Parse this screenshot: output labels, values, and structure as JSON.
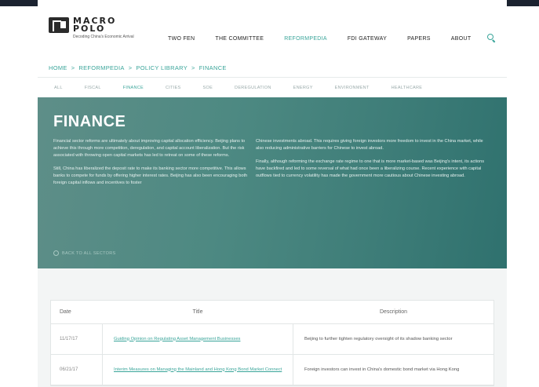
{
  "logo": {
    "line1": "MACRO",
    "line2": "POLO",
    "tagline": "Decoding China's Economic Arrival"
  },
  "nav": {
    "items": [
      {
        "label": "TWO FEN",
        "active": false
      },
      {
        "label": "THE COMMITTEE",
        "active": false
      },
      {
        "label": "REFORMPEDIA",
        "active": true
      },
      {
        "label": "FDI GATEWAY",
        "active": false
      },
      {
        "label": "PAPERS",
        "active": false
      },
      {
        "label": "ABOUT",
        "active": false
      }
    ],
    "search_icon": "search-icon"
  },
  "breadcrumb": {
    "items": [
      "HOME",
      "REFORMPEDIA",
      "POLICY LIBRARY",
      "FINANCE"
    ],
    "separator": ">"
  },
  "tabs": [
    {
      "label": "ALL",
      "active": false
    },
    {
      "label": "FISCAL",
      "active": false
    },
    {
      "label": "FINANCE",
      "active": true
    },
    {
      "label": "CITIES",
      "active": false
    },
    {
      "label": "SOE",
      "active": false
    },
    {
      "label": "DEREGULATION",
      "active": false
    },
    {
      "label": "ENERGY",
      "active": false
    },
    {
      "label": "ENVIRONMENT",
      "active": false
    },
    {
      "label": "HEALTHCARE",
      "active": false
    }
  ],
  "hero": {
    "title": "FINANCE",
    "left_paragraphs": [
      "Financial sector reforms are ultimately about improving capital allocation efficiency. Beijing plans to achieve this through more competition, deregulation, and capital account liberalization. But the risk associated with throwing open capital markets has led to retreat on some of these reforms.",
      "Still, China has liberalized the deposit rate to make its banking sector more competitive. This allows banks to compete for funds by offering higher interest rates. Beijing has also been encouraging both foreign capital inflows and incentives to foster"
    ],
    "right_paragraphs": [
      "Chinese investments abroad. This requires giving foreign investors more freedom to invest in the China market, while also reducing administrative barriers for Chinese to invest abroad.",
      "Finally, although reforming the exchange rate regime to one that is more market-based was Beijing's intent, its actions have backfired and led to some reversal of what had once been a liberalizing course. Recent experience with capital outflows tied to currency volatility has made the government more cautious about Chinese investing abroad."
    ],
    "back_link": "BACK TO ALL SECTORS"
  },
  "table": {
    "headers": {
      "date": "Date",
      "title": "Title",
      "description": "Description"
    },
    "rows": [
      {
        "date": "11/17/17",
        "title": "Guiding Opinion on Regulating Asset Management Businesses",
        "description": "Beijing to further tighten regulatory oversight of its shadow banking sector"
      },
      {
        "date": "06/21/17",
        "title": "Interim Measures on Managing the Mainland and Hong Kong Bond Market Connect",
        "description": "Foreign investors can invest in China's domestic bond market via Hong Kong"
      }
    ]
  },
  "colors": {
    "accent": "#3aa59a",
    "hero_start": "#5e8e88",
    "hero_end": "#2f716e"
  }
}
